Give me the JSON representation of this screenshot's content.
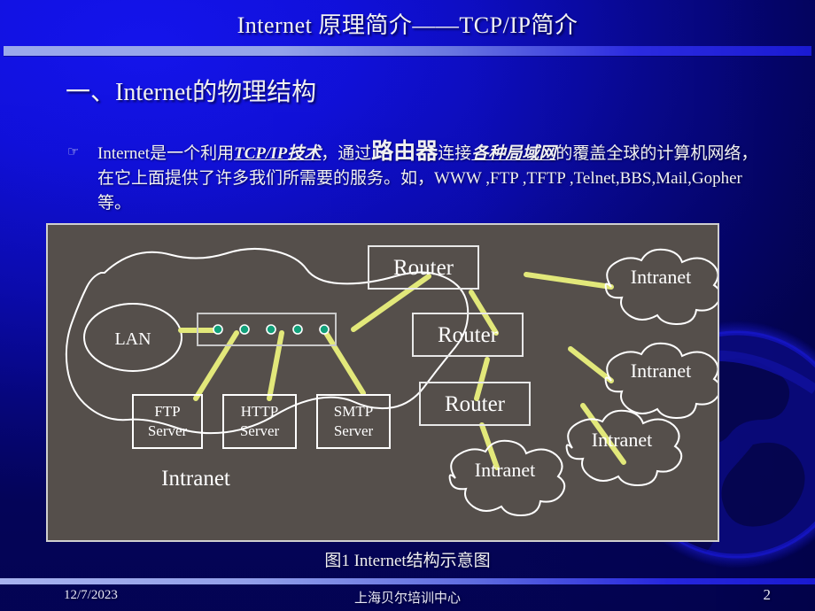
{
  "slide": {
    "title": "Internet 原理简介——TCP/IP简介",
    "heading": "一、Internet的物理结构",
    "caption": "图1 Internet结构示意图",
    "bullet_glyph": "☞"
  },
  "body": {
    "seg1": "Internet是一个利用",
    "seg2_bold_italic_underline": "TCP/IP技术",
    "seg3": "，通过",
    "seg4_big_bold": "路由器",
    "seg5": "连接",
    "seg6_bold_italic_underline": "各种局域网",
    "seg7": "的覆盖全球的计算机网络，在它上面提供了许多我们所需要的服务。如，WWW ,FTP ,TFTP ,Telnet,BBS,Mail,Gopher等。"
  },
  "diagram": {
    "lan_label": "LAN",
    "intranet_main_label": "Intranet",
    "servers": [
      {
        "line1": "FTP",
        "line2": "Server"
      },
      {
        "line1": "HTTP",
        "line2": "Server"
      },
      {
        "line1": "SMTP",
        "line2": "Server"
      }
    ],
    "routers": [
      {
        "label": "Router"
      },
      {
        "label": "Router"
      },
      {
        "label": "Router"
      }
    ],
    "clouds": [
      {
        "label": "Intranet"
      },
      {
        "label": "Intranet"
      },
      {
        "label": "Intranet"
      },
      {
        "label": "Intranet"
      }
    ],
    "hub_ports": 5,
    "colors": {
      "panel_bg": "#554f4b",
      "outline": "#ffffff",
      "link": "#e2e87a",
      "port_dot": "#12a07a",
      "box_border": "#e8e8e8"
    }
  },
  "footer": {
    "date": "12/7/2023",
    "center": "上海贝尔培训中心",
    "page": "2"
  },
  "theme": {
    "background_blue": "#1111e0",
    "rule_light": "#9aa8ec",
    "text": "#f0f0f0"
  }
}
